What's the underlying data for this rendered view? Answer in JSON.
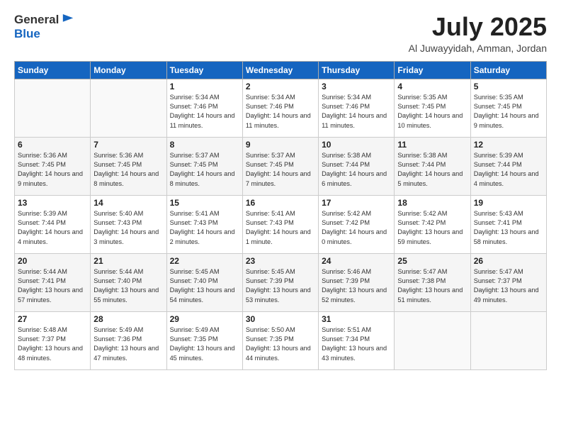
{
  "logo": {
    "general": "General",
    "blue": "Blue"
  },
  "title": {
    "month": "July 2025",
    "location": "Al Juwayyidah, Amman, Jordan"
  },
  "weekdays": [
    "Sunday",
    "Monday",
    "Tuesday",
    "Wednesday",
    "Thursday",
    "Friday",
    "Saturday"
  ],
  "weeks": [
    [
      {
        "day": "",
        "info": ""
      },
      {
        "day": "",
        "info": ""
      },
      {
        "day": "1",
        "info": "Sunrise: 5:34 AM\nSunset: 7:46 PM\nDaylight: 14 hours and 11 minutes."
      },
      {
        "day": "2",
        "info": "Sunrise: 5:34 AM\nSunset: 7:46 PM\nDaylight: 14 hours and 11 minutes."
      },
      {
        "day": "3",
        "info": "Sunrise: 5:34 AM\nSunset: 7:46 PM\nDaylight: 14 hours and 11 minutes."
      },
      {
        "day": "4",
        "info": "Sunrise: 5:35 AM\nSunset: 7:45 PM\nDaylight: 14 hours and 10 minutes."
      },
      {
        "day": "5",
        "info": "Sunrise: 5:35 AM\nSunset: 7:45 PM\nDaylight: 14 hours and 9 minutes."
      }
    ],
    [
      {
        "day": "6",
        "info": "Sunrise: 5:36 AM\nSunset: 7:45 PM\nDaylight: 14 hours and 9 minutes."
      },
      {
        "day": "7",
        "info": "Sunrise: 5:36 AM\nSunset: 7:45 PM\nDaylight: 14 hours and 8 minutes."
      },
      {
        "day": "8",
        "info": "Sunrise: 5:37 AM\nSunset: 7:45 PM\nDaylight: 14 hours and 8 minutes."
      },
      {
        "day": "9",
        "info": "Sunrise: 5:37 AM\nSunset: 7:45 PM\nDaylight: 14 hours and 7 minutes."
      },
      {
        "day": "10",
        "info": "Sunrise: 5:38 AM\nSunset: 7:44 PM\nDaylight: 14 hours and 6 minutes."
      },
      {
        "day": "11",
        "info": "Sunrise: 5:38 AM\nSunset: 7:44 PM\nDaylight: 14 hours and 5 minutes."
      },
      {
        "day": "12",
        "info": "Sunrise: 5:39 AM\nSunset: 7:44 PM\nDaylight: 14 hours and 4 minutes."
      }
    ],
    [
      {
        "day": "13",
        "info": "Sunrise: 5:39 AM\nSunset: 7:44 PM\nDaylight: 14 hours and 4 minutes."
      },
      {
        "day": "14",
        "info": "Sunrise: 5:40 AM\nSunset: 7:43 PM\nDaylight: 14 hours and 3 minutes."
      },
      {
        "day": "15",
        "info": "Sunrise: 5:41 AM\nSunset: 7:43 PM\nDaylight: 14 hours and 2 minutes."
      },
      {
        "day": "16",
        "info": "Sunrise: 5:41 AM\nSunset: 7:43 PM\nDaylight: 14 hours and 1 minute."
      },
      {
        "day": "17",
        "info": "Sunrise: 5:42 AM\nSunset: 7:42 PM\nDaylight: 14 hours and 0 minutes."
      },
      {
        "day": "18",
        "info": "Sunrise: 5:42 AM\nSunset: 7:42 PM\nDaylight: 13 hours and 59 minutes."
      },
      {
        "day": "19",
        "info": "Sunrise: 5:43 AM\nSunset: 7:41 PM\nDaylight: 13 hours and 58 minutes."
      }
    ],
    [
      {
        "day": "20",
        "info": "Sunrise: 5:44 AM\nSunset: 7:41 PM\nDaylight: 13 hours and 57 minutes."
      },
      {
        "day": "21",
        "info": "Sunrise: 5:44 AM\nSunset: 7:40 PM\nDaylight: 13 hours and 55 minutes."
      },
      {
        "day": "22",
        "info": "Sunrise: 5:45 AM\nSunset: 7:40 PM\nDaylight: 13 hours and 54 minutes."
      },
      {
        "day": "23",
        "info": "Sunrise: 5:45 AM\nSunset: 7:39 PM\nDaylight: 13 hours and 53 minutes."
      },
      {
        "day": "24",
        "info": "Sunrise: 5:46 AM\nSunset: 7:39 PM\nDaylight: 13 hours and 52 minutes."
      },
      {
        "day": "25",
        "info": "Sunrise: 5:47 AM\nSunset: 7:38 PM\nDaylight: 13 hours and 51 minutes."
      },
      {
        "day": "26",
        "info": "Sunrise: 5:47 AM\nSunset: 7:37 PM\nDaylight: 13 hours and 49 minutes."
      }
    ],
    [
      {
        "day": "27",
        "info": "Sunrise: 5:48 AM\nSunset: 7:37 PM\nDaylight: 13 hours and 48 minutes."
      },
      {
        "day": "28",
        "info": "Sunrise: 5:49 AM\nSunset: 7:36 PM\nDaylight: 13 hours and 47 minutes."
      },
      {
        "day": "29",
        "info": "Sunrise: 5:49 AM\nSunset: 7:35 PM\nDaylight: 13 hours and 45 minutes."
      },
      {
        "day": "30",
        "info": "Sunrise: 5:50 AM\nSunset: 7:35 PM\nDaylight: 13 hours and 44 minutes."
      },
      {
        "day": "31",
        "info": "Sunrise: 5:51 AM\nSunset: 7:34 PM\nDaylight: 13 hours and 43 minutes."
      },
      {
        "day": "",
        "info": ""
      },
      {
        "day": "",
        "info": ""
      }
    ]
  ]
}
